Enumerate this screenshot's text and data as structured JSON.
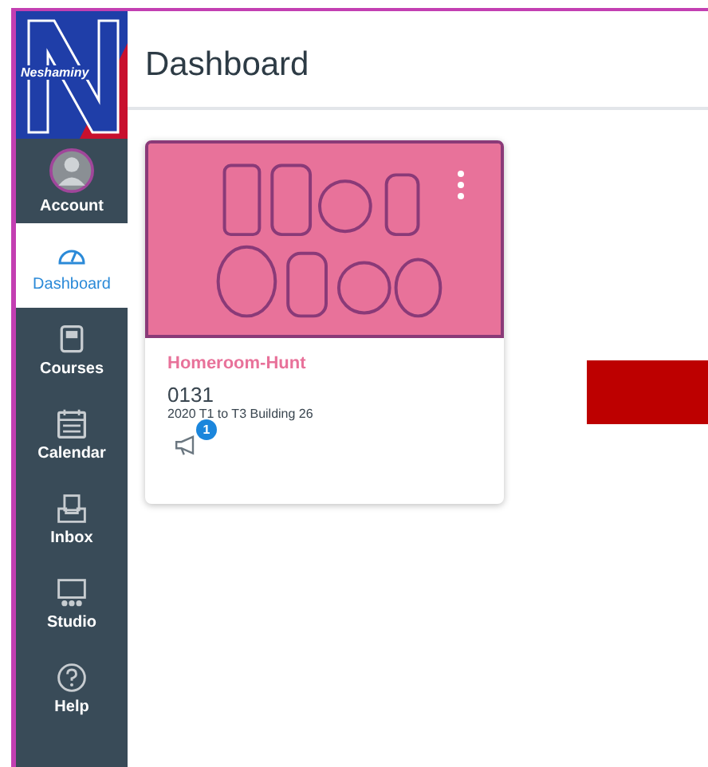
{
  "logo": {
    "text": "Neshaminy"
  },
  "nav": [
    {
      "label": "Account",
      "kind": "avatar",
      "selected": false
    },
    {
      "label": "Dashboard",
      "kind": "dashboard",
      "selected": true
    },
    {
      "label": "Courses",
      "kind": "courses",
      "selected": false
    },
    {
      "label": "Calendar",
      "kind": "calendar",
      "selected": false
    },
    {
      "label": "Inbox",
      "kind": "inbox",
      "selected": false
    },
    {
      "label": "Studio",
      "kind": "studio",
      "selected": false
    },
    {
      "label": "Help",
      "kind": "help",
      "selected": false
    }
  ],
  "page_title": "Dashboard",
  "cards": [
    {
      "color": "#e8729a",
      "name": "Homeroom-Hunt",
      "code": "0131",
      "term": "2020 T1 to T3 Building 26",
      "announcements_badge": "1"
    }
  ]
}
